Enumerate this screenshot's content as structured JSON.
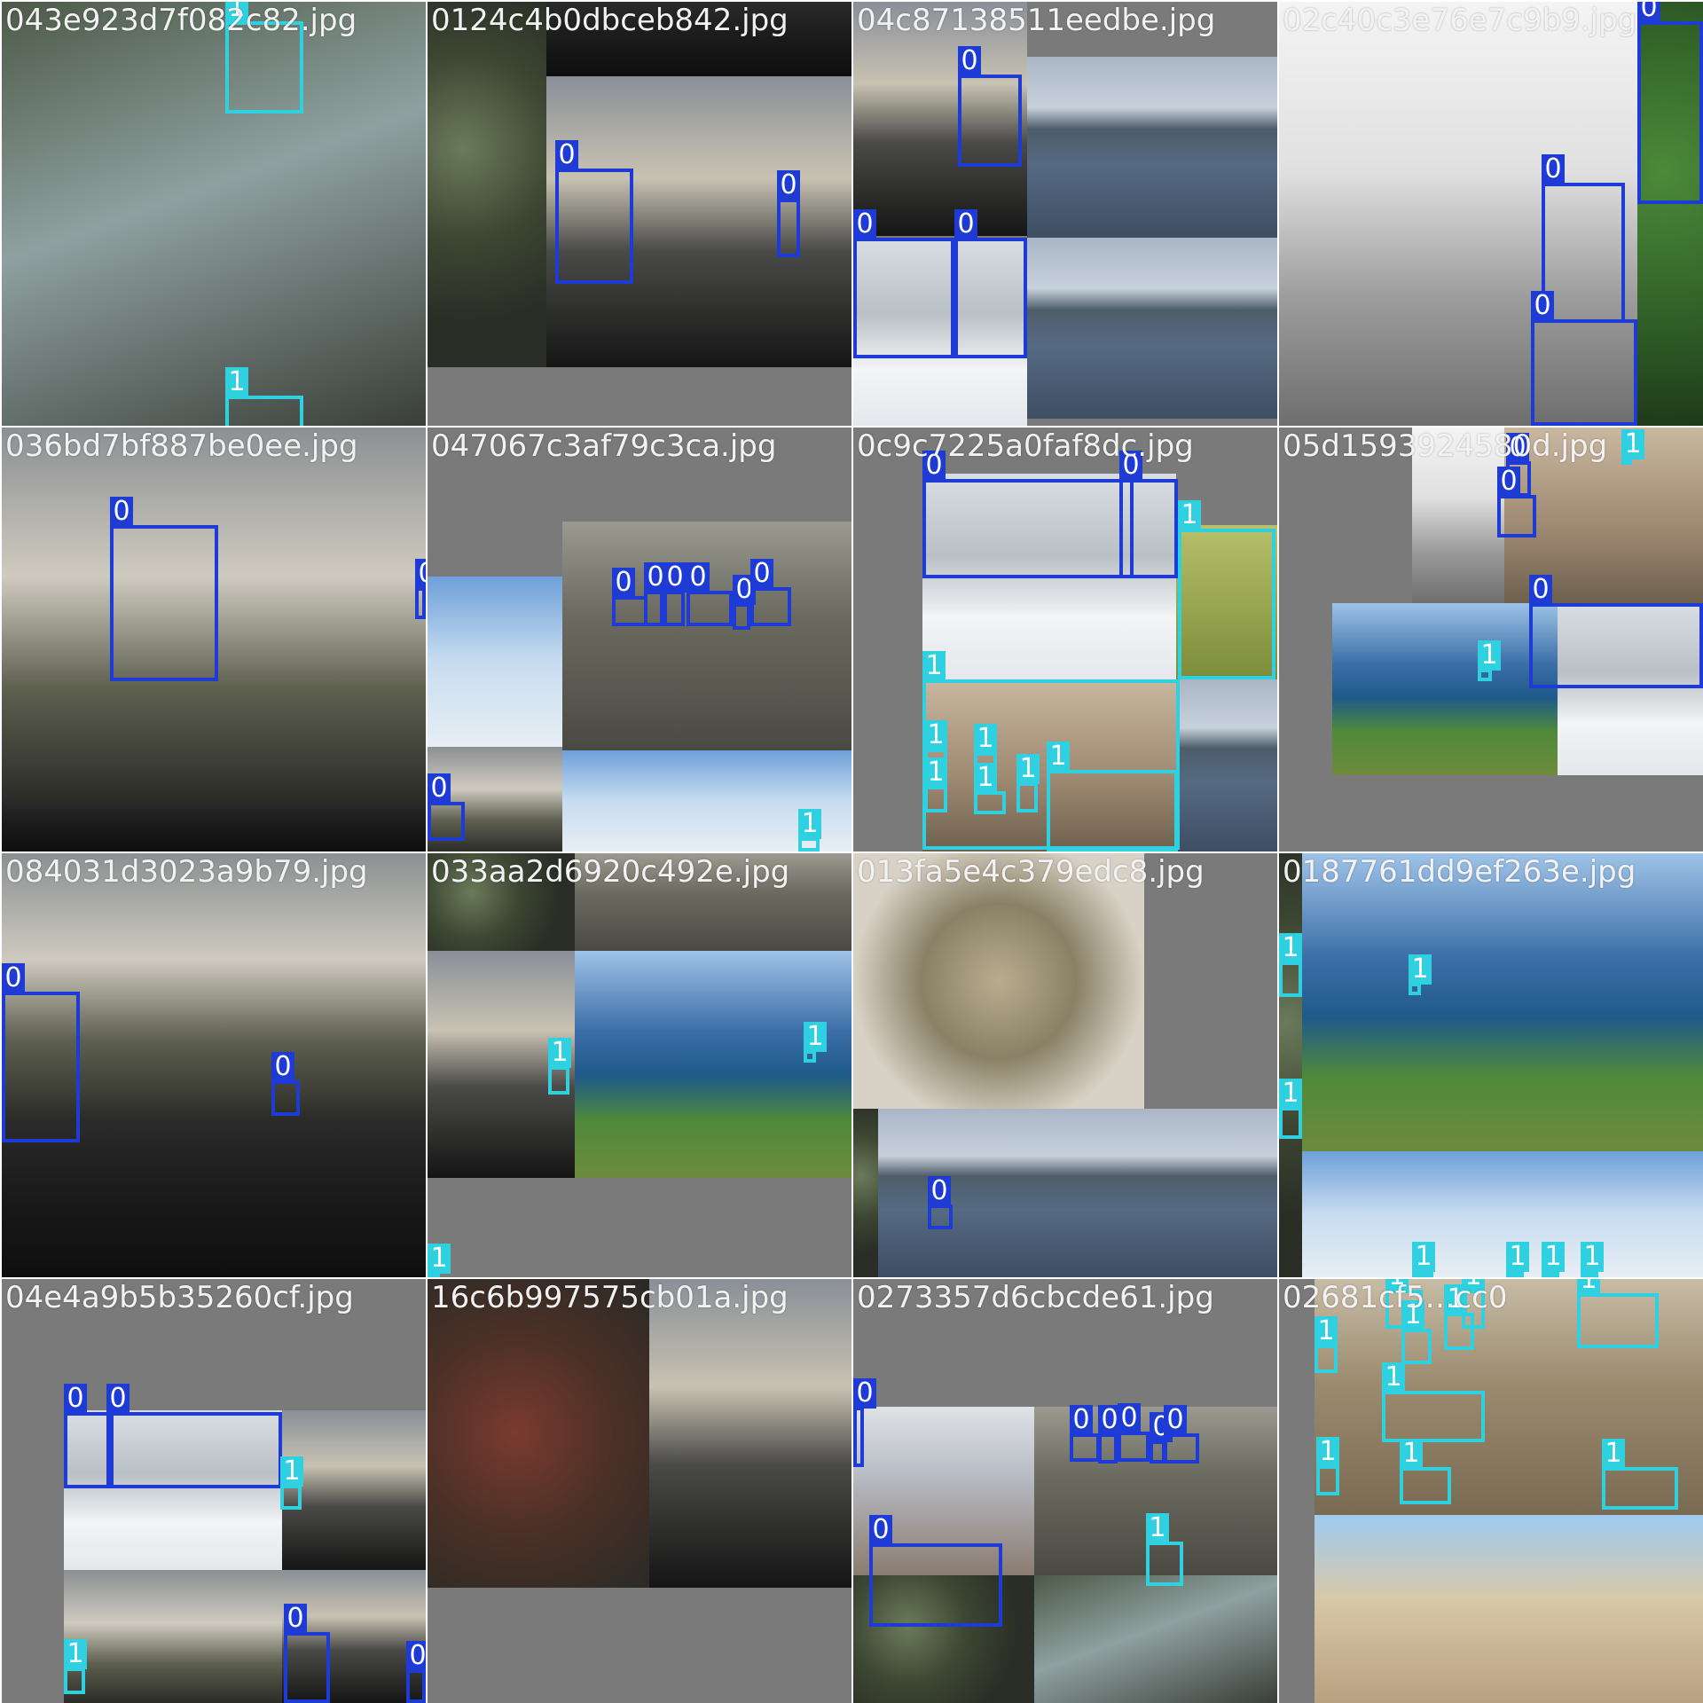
{
  "colors": {
    "class0": "#1f3bd6",
    "class1": "#2fd0e0",
    "background": "#7a7a7a"
  },
  "tiles": [
    {
      "filename": "043e923d7f082c82.jpg",
      "labels": [
        "1",
        "1"
      ]
    },
    {
      "filename": "0124c4b0dbceb842.jpg",
      "labels": [
        "0",
        "0"
      ]
    },
    {
      "filename": "04c87138511eedbe.jpg",
      "labels": [
        "0",
        "0",
        "0"
      ]
    },
    {
      "filename": "02c40c3e76e7c9b9.jpg",
      "labels": [
        "0",
        "0",
        "0"
      ]
    },
    {
      "filename": "036bd7bf887be0ee.jpg",
      "labels": [
        "0",
        "0"
      ]
    },
    {
      "filename": "047067c3af79c3ca.jpg",
      "labels": [
        "0",
        "0",
        "0",
        "0",
        "0",
        "0",
        "0",
        "1"
      ]
    },
    {
      "filename": "0c9c7225a0faf8dc.jpg",
      "labels": [
        "0",
        "0",
        "1",
        "1",
        "1",
        "1",
        "1",
        "1",
        "1",
        "1"
      ]
    },
    {
      "filename": "05d1593924580d.jpg",
      "labels": [
        "1",
        "0",
        "0",
        "0",
        "1"
      ]
    },
    {
      "filename": "084031d3023a9b79.jpg",
      "labels": [
        "0",
        "0"
      ]
    },
    {
      "filename": "033aa2d6920c492e.jpg",
      "labels": [
        "1",
        "1",
        "1"
      ]
    },
    {
      "filename": "013fa5e4c379edc8.jpg",
      "labels": [
        "0"
      ]
    },
    {
      "filename": "0187761dd9ef263e.jpg",
      "labels": [
        "1",
        "1",
        "1",
        "1",
        "1",
        "1",
        "1"
      ]
    },
    {
      "filename": "04e4a9b5b35260cf.jpg",
      "labels": [
        "0",
        "0",
        "1",
        "1",
        "0",
        "0"
      ]
    },
    {
      "filename": "16c6b997575cb01a.jpg",
      "labels": []
    },
    {
      "filename": "0273357d6cbcde61.jpg",
      "labels": [
        "0",
        "0",
        "0",
        "0",
        "0",
        "0",
        "0",
        "1"
      ]
    },
    {
      "filename": "02681cf5…cc0",
      "labels": [
        "1",
        "1",
        "1",
        "1",
        "1",
        "1",
        "1",
        "1",
        "1",
        "1"
      ]
    }
  ]
}
